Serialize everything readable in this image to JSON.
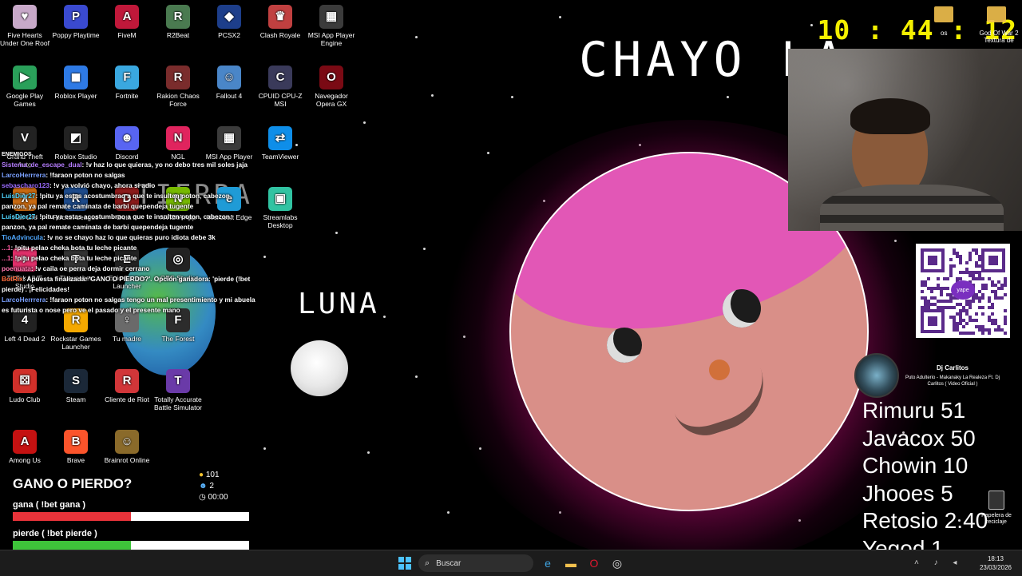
{
  "desktop": {
    "icons": [
      {
        "label": "Five Hearts Under One Roof",
        "glyph": "♥",
        "color": "#c8a9c9"
      },
      {
        "label": "Poppy Playtime",
        "glyph": "P",
        "color": "#3a4ad0"
      },
      {
        "label": "FiveM",
        "glyph": "A",
        "color": "#c0183a"
      },
      {
        "label": "R2Beat",
        "glyph": "R",
        "color": "#4a7a50"
      },
      {
        "label": "PCSX2",
        "glyph": "◆",
        "color": "#1d3e8a"
      },
      {
        "label": "Clash Royale",
        "glyph": "♛",
        "color": "#c04040"
      },
      {
        "label": "MSI App Player Engine",
        "glyph": "▦",
        "color": "#3b3b3b"
      },
      {
        "label": "Google Play Games",
        "glyph": "▶",
        "color": "#2aa05a"
      },
      {
        "label": "Roblox Player",
        "glyph": "◼",
        "color": "#2e7ae5"
      },
      {
        "label": "Fortnite",
        "glyph": "F",
        "color": "#3aa8e0"
      },
      {
        "label": "Rakion Chaos Force",
        "glyph": "R",
        "color": "#7a2c2c"
      },
      {
        "label": "Fallout 4",
        "glyph": "☺",
        "color": "#4a86c8"
      },
      {
        "label": "CPUID CPU-Z MSI",
        "glyph": "C",
        "color": "#3a3a5a"
      },
      {
        "label": "Navegador Opera GX",
        "glyph": "O",
        "color": "#7a0a14"
      },
      {
        "label": "Grand Theft Auto",
        "glyph": "V",
        "color": "#222"
      },
      {
        "label": "Roblox Studio",
        "glyph": "◩",
        "color": "#222"
      },
      {
        "label": "Discord",
        "glyph": "☻",
        "color": "#5865f2"
      },
      {
        "label": "NGL",
        "glyph": "N",
        "color": "#e0245e"
      },
      {
        "label": "MSI App Player",
        "glyph": "▦",
        "color": "#3b3b3b"
      },
      {
        "label": "TeamViewer",
        "glyph": "⇄",
        "color": "#0e8ee9"
      },
      {
        "label": "Half-Life",
        "glyph": "λ",
        "color": "#c86a12"
      },
      {
        "label": "Rocket League",
        "glyph": "R",
        "color": "#1d4a8a"
      },
      {
        "label": "Dota 2",
        "glyph": "D",
        "color": "#8a1a1a"
      },
      {
        "label": "NVIDIA App",
        "glyph": "N",
        "color": "#76b900"
      },
      {
        "label": "Microsoft Edge",
        "glyph": "e",
        "color": "#1f9bd6"
      },
      {
        "label": "Streamlabs Desktop",
        "glyph": "▣",
        "color": "#31c3a2"
      },
      {
        "label": "TikTok LIVE Studio",
        "glyph": "♪",
        "color": "#e0306a"
      },
      {
        "label": "TLauncher",
        "glyph": "T",
        "color": "#333"
      },
      {
        "label": "Epic Games Launcher",
        "glyph": "E",
        "color": "#222"
      },
      {
        "label": "OBS Studio",
        "glyph": "◎",
        "color": "#222"
      },
      {
        "label": "Left 4 Dead 2",
        "glyph": "4",
        "color": "#222"
      },
      {
        "label": "Rockstar Games Launcher",
        "glyph": "R",
        "color": "#f4a800"
      },
      {
        "label": "Tu madre",
        "glyph": "♀",
        "color": "#6a6a6a"
      },
      {
        "label": "The Forest",
        "glyph": "F",
        "color": "#2c2c2c"
      },
      {
        "label": "Ludo Club",
        "glyph": "⚄",
        "color": "#d0302a"
      },
      {
        "label": "Steam",
        "glyph": "S",
        "color": "#1b2838"
      },
      {
        "label": "Cliente de Riot",
        "glyph": "R",
        "color": "#d13639"
      },
      {
        "label": "Totally Accurate Battle Simulator",
        "glyph": "T",
        "color": "#6a3aa8"
      },
      {
        "label": "Among Us",
        "glyph": "A",
        "color": "#c51111"
      },
      {
        "label": "Brave",
        "glyph": "B",
        "color": "#fb542b"
      },
      {
        "label": "Brainrot Online",
        "glyph": "☺",
        "color": "#8a6a2a"
      }
    ],
    "right_icons": [
      "os",
      "God Of War 2 Textura de",
      "Papelera de reciclaje"
    ]
  },
  "chat": {
    "title": "ENEMIGOS",
    "messages": [
      {
        "user": "Sistema_de_escape_dual",
        "color": "#b67dff",
        "text": ": !v haz lo que quieras, yo no debo tres mil soles jaja"
      },
      {
        "user": "LarcoHerrrera",
        "color": "#7aa0ff",
        "text": ": !faraon poton no salgas"
      },
      {
        "user": "sebascharo123",
        "color": "#9a6bff",
        "text": ": !v ya volvió chayo, ahora si adio"
      },
      {
        "user": "LuisDier27",
        "color": "#4fd6ff",
        "text": ": !pitu ya estas acostumbrao a que te insulten poton, cabezon, panzon, ya pal remate caminata de barbi quependeja tugente"
      },
      {
        "user": "LuisDier27",
        "color": "#4fd6ff",
        "text": ": !pitu ya estas acostumbrao a que te insulten poton, cabezon, panzon, ya pal remate caminata de barbi quependeja tugente"
      },
      {
        "user": "TioAdvincula",
        "color": "#4fa8ff",
        "text": ": !v no se chayo haz lo que quieras puro idiota debe 3k"
      },
      {
        "user": "...1",
        "color": "#ff5aa0",
        "text": ": !pitu pelao cheka bota tu leche picante"
      },
      {
        "user": "...1",
        "color": "#ff5aa0",
        "text": ": !pitu pelao cheka bota tu leche picante"
      },
      {
        "user": "poenuata",
        "color": "#ff7ab0",
        "text": ": !v caila oe perra deja dormir cerrano"
      },
      {
        "user": "BotRix",
        "color": "#ff6a3a",
        "text": ": Apuesta finalizada: 'GANO O PIERDO?'. Opción ganadora: 'pierde (!bet pierde)'. ¡Felicidades!"
      },
      {
        "user": "LarcoHerrrera",
        "color": "#7aa0ff",
        "text": ": !faraon poton no salgas tengo un mal presentimiento y mi abuela es futurista o nose pero ve el pasado y el presente mano"
      }
    ]
  },
  "poll": {
    "title": "GANO O PIERDO?",
    "coins": "101",
    "users": "2",
    "time": "00:00",
    "options": [
      {
        "label": "gana ( !bet gana )",
        "fraction": 0.5,
        "color": "#e8333a"
      },
      {
        "label": "pierde ( !bet pierde )",
        "fraction": 0.5,
        "color": "#3ec43a"
      }
    ]
  },
  "drawing": {
    "title_text": "CHAYO LA",
    "moon_label": "LUNA",
    "partial_label": "TIERRA"
  },
  "clock": {
    "h": "10",
    "m": "44",
    "s": "12"
  },
  "now_playing": {
    "artist": "Dj Carlitos",
    "title": "Puto Adulterio - Makanaky La Realeza Ft. Dj Carlitos ( Video Oficial )"
  },
  "qr": {
    "label": "yape"
  },
  "leaderboard": [
    "Rimuru 51",
    "Javacox 50",
    "Chowin 10",
    "Jhooes 5",
    "Retosio 2.40",
    "Yegod 1"
  ],
  "taskbar": {
    "search_placeholder": "Buscar",
    "time": "18:13",
    "date": "23/03/2026"
  }
}
